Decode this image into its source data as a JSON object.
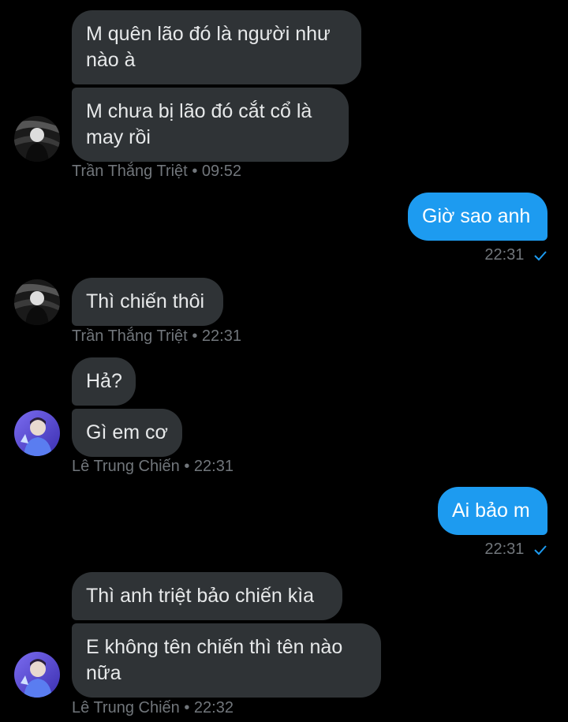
{
  "colors": {
    "background": "#000000",
    "incoming_bubble": "#2f3336",
    "outgoing_bubble": "#1d9bf0",
    "meta_text": "#71767b",
    "check": "#1d9bf0"
  },
  "messages": [
    {
      "text": "M quên lão đó là người như nào à"
    },
    {
      "text": "M chưa bị lão đó cắt cổ là may rồi"
    },
    {
      "sender": "Trần Thắng Triệt",
      "time": "09:52"
    },
    {
      "text": "Giờ sao anh",
      "time": "22:31"
    },
    {
      "text": "Thì chiến thôi"
    },
    {
      "sender": "Trần Thắng Triệt",
      "time": "22:31"
    },
    {
      "text": "Hả?"
    },
    {
      "text": "Gì em cơ"
    },
    {
      "sender": "Lê Trung Chiến",
      "time": "22:31"
    },
    {
      "text": "Ai bảo m",
      "time": "22:31"
    },
    {
      "text": "Thì anh triệt bảo chiến kìa"
    },
    {
      "text": "E không tên chiến thì tên nào nữa"
    },
    {
      "sender": "Lê Trung Chiến",
      "time": "22:32"
    }
  ],
  "separator": "•",
  "icons": {
    "avatar_triet": "avatar-dark-photo",
    "avatar_chien": "avatar-purple-photo",
    "read_check": "check-icon"
  }
}
